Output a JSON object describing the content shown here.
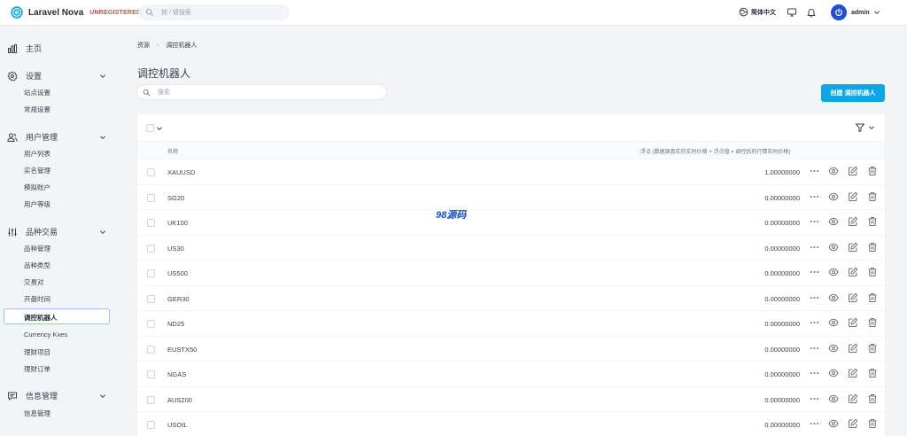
{
  "header": {
    "app_name": "Laravel Nova",
    "license_badge": "UNREGISTERED",
    "search_placeholder": "按 / 键搜索",
    "language": "简体中文",
    "user_name": "admin"
  },
  "sidebar": {
    "home_label": "主页",
    "groups": [
      {
        "label": "设置",
        "items": [
          "站点设置",
          "常规设置"
        ]
      },
      {
        "label": "用户管理",
        "items": [
          "用户列表",
          "实名管理",
          "模拟账户",
          "用户等级"
        ]
      },
      {
        "label": "品种交易",
        "items": [
          "品种管理",
          "品种类型",
          "交易对",
          "开盘时间",
          "调控机器人",
          "Currency Kxes",
          "理财项目",
          "理财订单"
        ]
      },
      {
        "label": "信息管理",
        "items": [
          "信息管理"
        ]
      }
    ],
    "active_item": "调控机器人"
  },
  "breadcrumb": {
    "root": "资源",
    "current": "调控机器人"
  },
  "page": {
    "title": "调控机器人",
    "search_placeholder": "搜索",
    "create_button": "创建 调控机器人"
  },
  "table": {
    "columns": {
      "name": "名称",
      "float": "浮点 (数据源真实的实时价格 + 浮点值 = 调控后的行情实时价格)"
    },
    "rows": [
      {
        "name": "XAUUSD",
        "value": "1.00000000"
      },
      {
        "name": "SG20",
        "value": "0.00000000"
      },
      {
        "name": "UK100",
        "value": "0.00000000"
      },
      {
        "name": "US30",
        "value": "0.00000000"
      },
      {
        "name": "US500",
        "value": "0.00000000"
      },
      {
        "name": "GER30",
        "value": "0.00000000"
      },
      {
        "name": "ND25",
        "value": "0.00000000"
      },
      {
        "name": "EUSTX50",
        "value": "0.00000000"
      },
      {
        "name": "NGAS",
        "value": "0.00000000"
      },
      {
        "name": "AUS200",
        "value": "0.00000000"
      },
      {
        "name": "USOIL",
        "value": "0.00000000"
      }
    ]
  },
  "watermark": "98源码",
  "colors": {
    "accent": "#0ea5e9",
    "brand": "#1d4ed8",
    "danger": "#ef4444"
  }
}
